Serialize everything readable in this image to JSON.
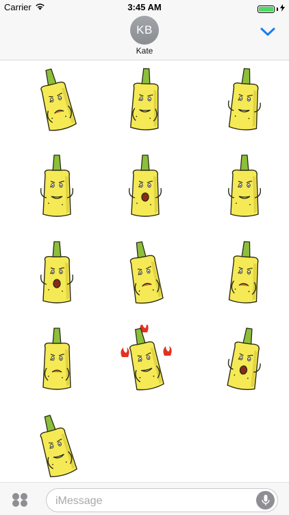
{
  "status_bar": {
    "carrier": "Carrier",
    "time": "3:45 AM",
    "wifi_icon": "wifi-icon",
    "battery_icon": "battery-icon",
    "charging_icon": "bolt-icon",
    "battery_color": "#4cd964"
  },
  "header": {
    "avatar_initials": "KB",
    "contact_name": "Kate",
    "collapse_icon": "chevron-down-icon",
    "accent_color": "#1a7cf5"
  },
  "stickers": [
    {
      "pose": "sad-holding-face"
    },
    {
      "pose": "scared-gritting-teeth"
    },
    {
      "pose": "laughing-pointing"
    },
    {
      "pose": "worried-hands-up"
    },
    {
      "pose": "screaming-hands-up"
    },
    {
      "pose": "grinning-thumbs-up"
    },
    {
      "pose": "terrified-praying"
    },
    {
      "pose": "crying"
    },
    {
      "pose": "annoyed-arms-crossed"
    },
    {
      "pose": "disgusted"
    },
    {
      "pose": "angry-fire"
    },
    {
      "pose": "shocked-hands-up"
    },
    {
      "pose": "facepalm"
    }
  ],
  "input_bar": {
    "apps_icon": "app-drawer-icon",
    "placeholder": "iMessage",
    "mic_icon": "microphone-icon"
  }
}
